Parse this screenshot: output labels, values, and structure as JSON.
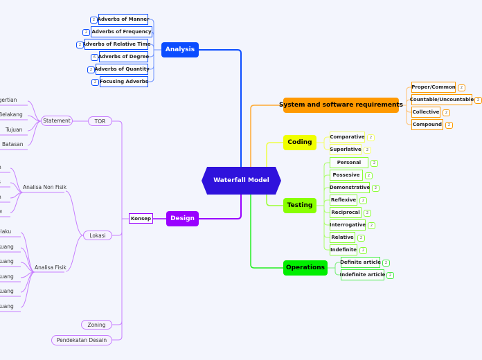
{
  "central": {
    "label": "Waterfall Model",
    "color": "#2f12dc"
  },
  "analysis": {
    "label": "Analysis",
    "color": "#0b4dff",
    "children": [
      {
        "label": "Adverbs of Manner",
        "badge": "2"
      },
      {
        "label": "Adverbs of Frequency",
        "badge": "2"
      },
      {
        "label": "Adverbs of Relative Time",
        "badge": "2"
      },
      {
        "label": "Adverbs of Degree",
        "badge": "6"
      },
      {
        "label": "Adverbs of Quantity",
        "badge": "2"
      },
      {
        "label": "Focusing Adverbs",
        "badge": "2"
      }
    ]
  },
  "system": {
    "label": "System and software requirements",
    "color": "#ff9900",
    "children": [
      {
        "label": "Proper/Common",
        "badge": "2"
      },
      {
        "label": "Countable/Uncountable",
        "badge": "2"
      },
      {
        "label": "Collective",
        "badge": "2"
      },
      {
        "label": "Compound",
        "badge": "2"
      }
    ]
  },
  "coding": {
    "label": "Coding",
    "color": "#f0ff00",
    "children": [
      {
        "label": "Comparative",
        "badge": "2"
      },
      {
        "label": "Superlative",
        "badge": "2"
      }
    ]
  },
  "testing": {
    "label": "Testing",
    "color": "#88ff00",
    "children": [
      {
        "label": "Personal",
        "badge": "2"
      },
      {
        "label": "Possesive",
        "badge": "2"
      },
      {
        "label": "Demonstrative",
        "badge": "2"
      },
      {
        "label": "Reflexive",
        "badge": "2"
      },
      {
        "label": "Reciprocal",
        "badge": "2"
      },
      {
        "label": "Interrogative",
        "badge": "2"
      },
      {
        "label": "Relative",
        "badge": "2"
      },
      {
        "label": "Indefinite",
        "badge": "2"
      }
    ]
  },
  "operations": {
    "label": "Operations",
    "color": "#00ee00",
    "children": [
      {
        "label": "Definite article",
        "badge": "2"
      },
      {
        "label": "Indefinite article",
        "badge": "2"
      }
    ]
  },
  "design": {
    "label": "Design",
    "color": "#9900ff",
    "konsep": "Konsep",
    "tor": "TOR",
    "statement": "Statement",
    "statement_children": [
      "Pengertian",
      "Belakang",
      "Tujuan",
      "Batasan"
    ],
    "lokasi": "Lokasi",
    "non_fisik": "Analisa Non Fisik",
    "non_fisik_children": [
      "n",
      "s",
      "n",
      "w"
    ],
    "fisik": "Analisa Fisik",
    "fisik_children": [
      "elaku",
      "Ruang",
      "Ruang",
      "Ruang",
      "Ruang",
      "Ruang"
    ],
    "zoning": "Zoning",
    "pendekatan": "Pendekatan Desain"
  }
}
